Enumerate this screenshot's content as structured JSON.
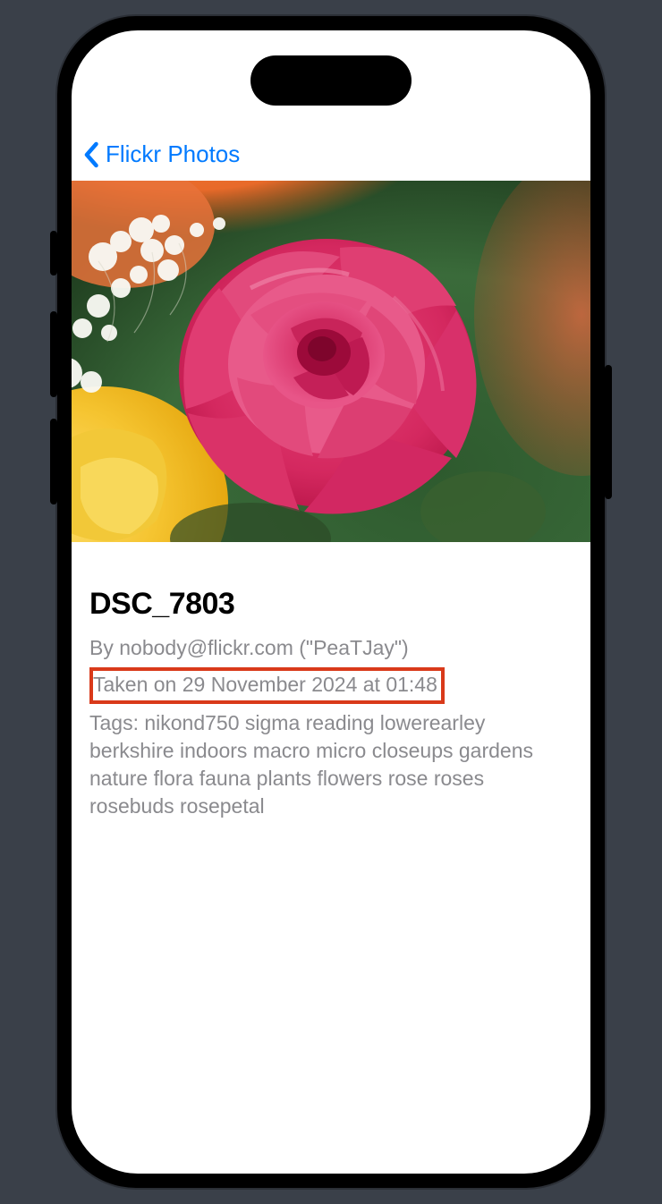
{
  "nav": {
    "back_label": "Flickr Photos"
  },
  "photo": {
    "title": "DSC_7803",
    "byline": "By nobody@flickr.com (\"PeaTJay\")",
    "taken": "Taken on 29 November 2024 at 01:48",
    "tags": "Tags: nikond750 sigma reading lowerearley berkshire indoors macro micro closeups gardens nature flora fauna plants flowers rose roses rosebuds rosepetal"
  }
}
